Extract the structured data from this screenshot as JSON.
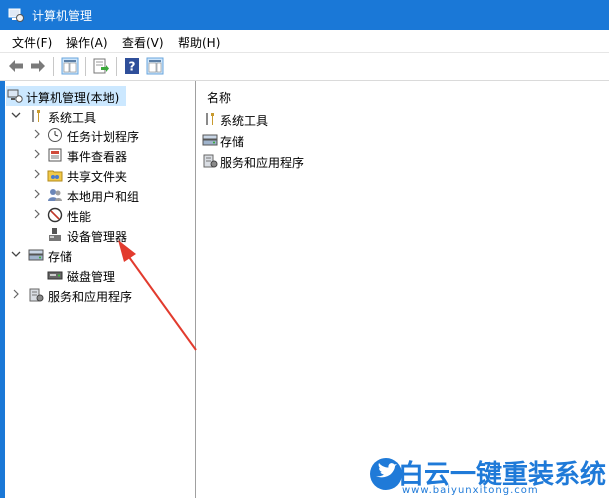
{
  "window": {
    "title": "计算机管理"
  },
  "menu": [
    {
      "label": "文件(F)"
    },
    {
      "label": "操作(A)"
    },
    {
      "label": "查看(V)"
    },
    {
      "label": "帮助(H)"
    }
  ],
  "toolbar": {
    "buttons": [
      "back-arrow-icon",
      "forward-arrow-icon",
      "show-hide-tree-icon",
      "export-list-icon",
      "help-icon",
      "properties-pane-icon"
    ]
  },
  "tree": {
    "root": "计算机管理(本地)",
    "system_tools": "系统工具",
    "task_scheduler": "任务计划程序",
    "event_viewer": "事件查看器",
    "shared_folders": "共享文件夹",
    "local_users_groups": "本地用户和组",
    "performance": "性能",
    "device_manager": "设备管理器",
    "storage": "存储",
    "disk_management": "磁盘管理",
    "services_apps": "服务和应用程序"
  },
  "details": {
    "column_header": "名称",
    "items": [
      "系统工具",
      "存储",
      "服务和应用程序"
    ]
  },
  "watermark": {
    "brand": "白云一键重装系统",
    "url": "www.baiyunxitong.com"
  },
  "colors": {
    "titlebar": "#1a78d7",
    "selection": "#cce8ff",
    "arrow": "#e23b2e",
    "watermark": "#1f7ad8"
  }
}
